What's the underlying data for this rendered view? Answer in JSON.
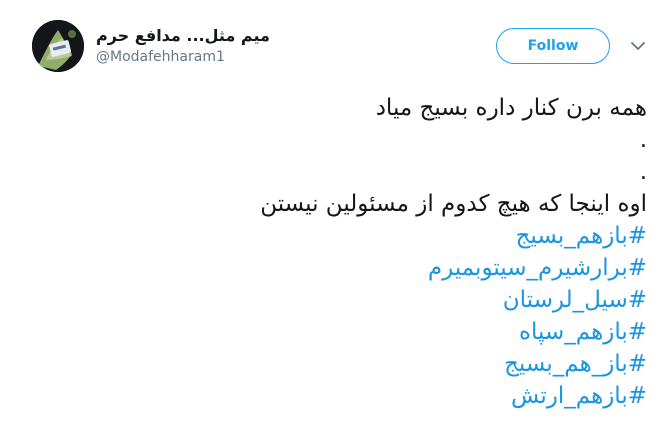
{
  "user": {
    "display_name": "میم مثل... مدافع حرم",
    "handle": "@Modafehharam1"
  },
  "follow_button": {
    "label": "Follow"
  },
  "icons": {
    "menu": "chevron-down-icon",
    "avatar": "avatar"
  },
  "colors": {
    "accent": "#1da1f2",
    "hashtag": "#1b95e0",
    "text": "#14171a",
    "secondary": "#657786"
  },
  "tweet": {
    "line1": "همه برن کنار داره بسیج میاد",
    "dot1": ".",
    "dot2": ".",
    "line2": "اوه اینجا که هیچ کدوم از مسئولین نیستن",
    "hashtags": [
      "#بازهم_بسیج",
      "#برارشیرم_سیتوبمیرم",
      "#سیل_لرستان",
      "#بازهم_سپاه",
      "#باز_هم_بسیج",
      "#بازهم_ارتش"
    ]
  }
}
